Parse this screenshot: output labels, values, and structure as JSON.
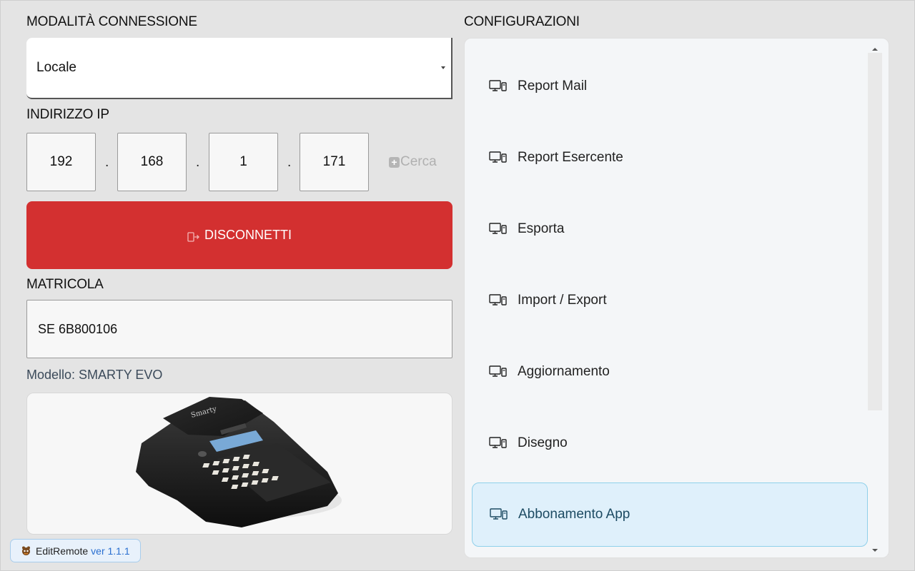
{
  "connection": {
    "label": "MODALITÀ CONNESSIONE",
    "selected": "Locale"
  },
  "ip": {
    "label": "INDIRIZZO IP",
    "octets": [
      "192",
      "168",
      "1",
      "171"
    ],
    "separator": ".",
    "search_label": "Cerca"
  },
  "disconnect": {
    "label": "DISCONNETTI",
    "color": "#d33030"
  },
  "matricola": {
    "label": "MATRICOLA",
    "value": "SE 6B800106"
  },
  "model": {
    "text": "Modello: SMARTY EVO",
    "device_logo_text": "Smarty"
  },
  "footer": {
    "app_name": "EditRemote",
    "version": "ver 1.1.1"
  },
  "configs": {
    "label": "CONFIGURAZIONI",
    "items": [
      {
        "label": "Report Mail",
        "icon": "computer-icon"
      },
      {
        "label": "Report Esercente",
        "icon": "computer-icon"
      },
      {
        "label": "Esporta",
        "icon": "computer-icon"
      },
      {
        "label": "Import / Export",
        "icon": "computer-icon"
      },
      {
        "label": "Aggiornamento",
        "icon": "computer-icon"
      },
      {
        "label": "Disegno",
        "icon": "computer-icon"
      },
      {
        "label": "Abbonamento App",
        "icon": "computer-icon",
        "active": true
      }
    ],
    "active_color": "#dff0fb"
  }
}
